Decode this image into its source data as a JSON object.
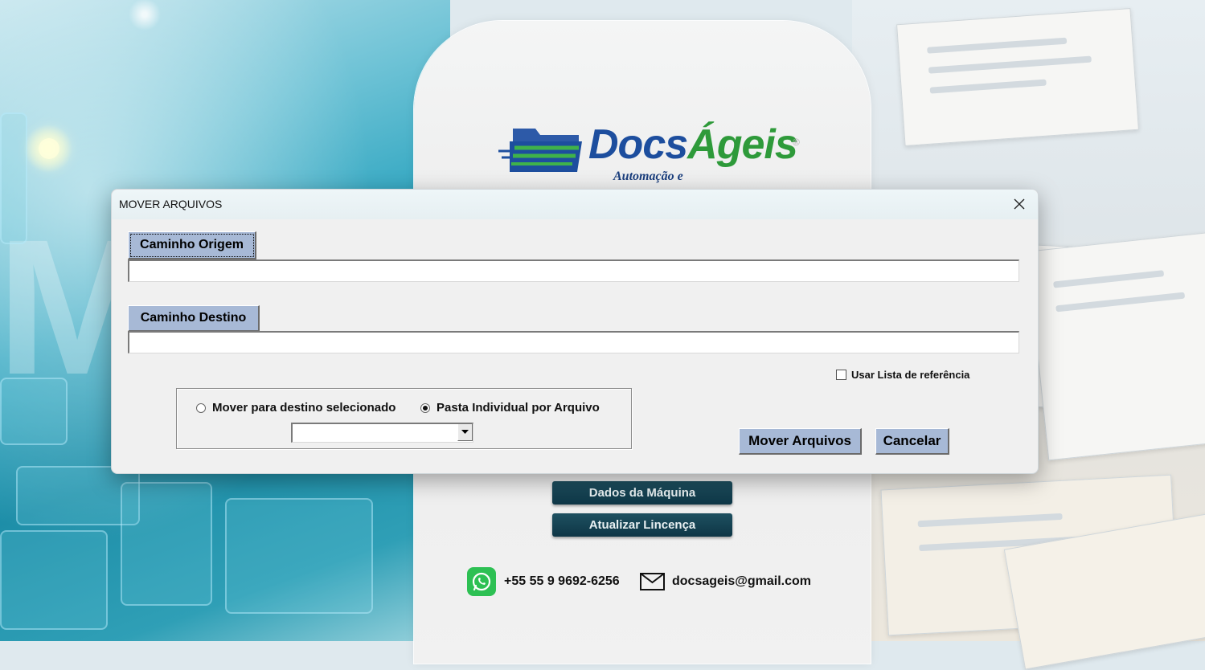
{
  "background": {
    "brand": {
      "part1": "Docs",
      "part2": "Ágeis",
      "registered": "®",
      "tagline": "Automação e"
    },
    "buttons": {
      "machine_data": "Dados da Máquina",
      "update_license": "Atualizar Lincença"
    },
    "contact": {
      "phone": "+55 55 9 9692-6256",
      "email": "docsageis@gmail.com"
    },
    "colors": {
      "brand_blue": "#1d4e9e",
      "brand_green": "#2e9a3a",
      "whatsapp": "#2dc053",
      "dark_button": "#0e3646"
    }
  },
  "dialog": {
    "title": "MOVER ARQUIVOS",
    "source": {
      "button_label": "Caminho Origem",
      "value": ""
    },
    "destination": {
      "button_label": "Caminho Destino",
      "value": ""
    },
    "reference_list": {
      "label": "Usar Lista de referência",
      "checked": false
    },
    "move_mode": {
      "options": [
        {
          "label": "Mover para destino selecionado",
          "selected": false
        },
        {
          "label": "Pasta Individual por Arquivo",
          "selected": true
        }
      ],
      "dropdown_value": ""
    },
    "actions": {
      "move": "Mover Arquivos",
      "cancel": "Cancelar"
    },
    "colors": {
      "button_face": "#a7b9d6",
      "dialog_bg": "#f0f0f0"
    }
  }
}
